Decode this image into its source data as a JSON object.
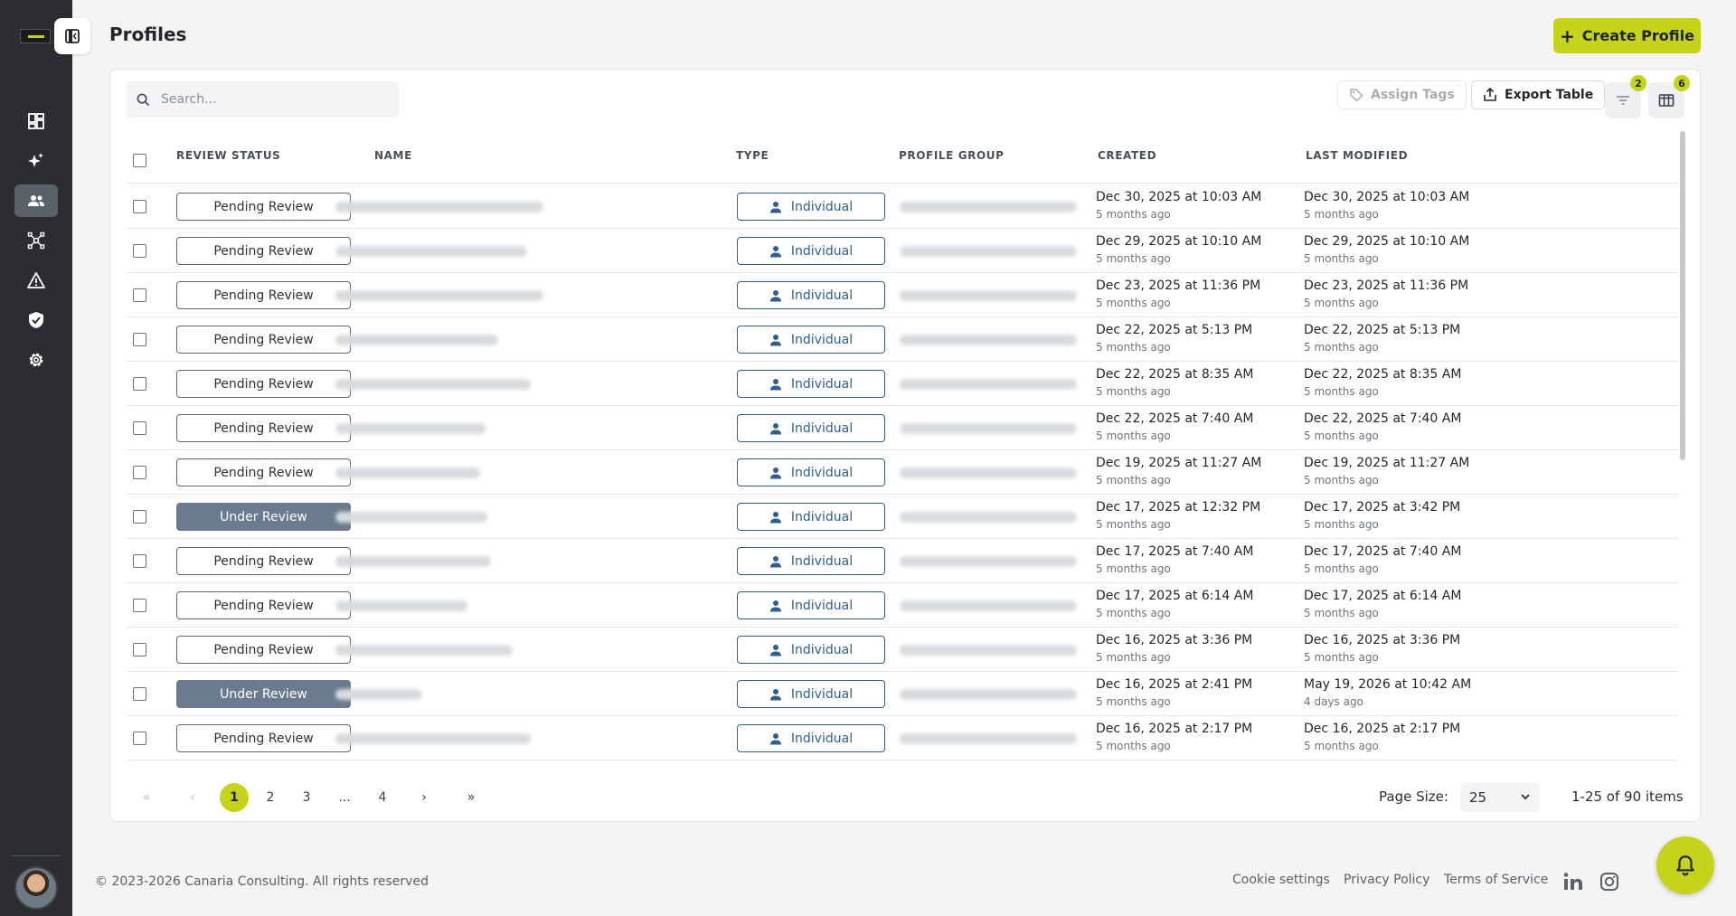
{
  "header": {
    "title": "Profiles",
    "create_label": "Create Profile"
  },
  "toolbar": {
    "search_placeholder": "Search...",
    "assign_tags_label": "Assign Tags",
    "export_label": "Export Table",
    "filter_count": "2",
    "columns_count": "6"
  },
  "table": {
    "columns": [
      "REVIEW STATUS",
      "NAME",
      "TYPE",
      "PROFILE GROUP",
      "CREATED",
      "LAST MODIFIED"
    ],
    "rows": [
      {
        "status": "Pending Review",
        "type": "Individual",
        "created": "Dec 30, 2025 at 10:03 AM",
        "created_ago": "5 months ago",
        "modified": "Dec 30, 2025 at 10:03 AM",
        "modified_ago": "5 months ago"
      },
      {
        "status": "Pending Review",
        "type": "Individual",
        "created": "Dec 29, 2025 at 10:10 AM",
        "created_ago": "5 months ago",
        "modified": "Dec 29, 2025 at 10:10 AM",
        "modified_ago": "5 months ago"
      },
      {
        "status": "Pending Review",
        "type": "Individual",
        "created": "Dec 23, 2025 at 11:36 PM",
        "created_ago": "5 months ago",
        "modified": "Dec 23, 2025 at 11:36 PM",
        "modified_ago": "5 months ago"
      },
      {
        "status": "Pending Review",
        "type": "Individual",
        "created": "Dec 22, 2025 at 5:13 PM",
        "created_ago": "5 months ago",
        "modified": "Dec 22, 2025 at 5:13 PM",
        "modified_ago": "5 months ago"
      },
      {
        "status": "Pending Review",
        "type": "Individual",
        "created": "Dec 22, 2025 at 8:35 AM",
        "created_ago": "5 months ago",
        "modified": "Dec 22, 2025 at 8:35 AM",
        "modified_ago": "5 months ago"
      },
      {
        "status": "Pending Review",
        "type": "Individual",
        "created": "Dec 22, 2025 at 7:40 AM",
        "created_ago": "5 months ago",
        "modified": "Dec 22, 2025 at 7:40 AM",
        "modified_ago": "5 months ago"
      },
      {
        "status": "Pending Review",
        "type": "Individual",
        "created": "Dec 19, 2025 at 11:27 AM",
        "created_ago": "5 months ago",
        "modified": "Dec 19, 2025 at 11:27 AM",
        "modified_ago": "5 months ago"
      },
      {
        "status": "Under Review",
        "type": "Individual",
        "created": "Dec 17, 2025 at 12:32 PM",
        "created_ago": "5 months ago",
        "modified": "Dec 17, 2025 at 3:42 PM",
        "modified_ago": "5 months ago"
      },
      {
        "status": "Pending Review",
        "type": "Individual",
        "created": "Dec 17, 2025 at 7:40 AM",
        "created_ago": "5 months ago",
        "modified": "Dec 17, 2025 at 7:40 AM",
        "modified_ago": "5 months ago"
      },
      {
        "status": "Pending Review",
        "type": "Individual",
        "created": "Dec 17, 2025 at 6:14 AM",
        "created_ago": "5 months ago",
        "modified": "Dec 17, 2025 at 6:14 AM",
        "modified_ago": "5 months ago"
      },
      {
        "status": "Pending Review",
        "type": "Individual",
        "created": "Dec 16, 2025 at 3:36 PM",
        "created_ago": "5 months ago",
        "modified": "Dec 16, 2025 at 3:36 PM",
        "modified_ago": "5 months ago"
      },
      {
        "status": "Under Review",
        "type": "Individual",
        "created": "Dec 16, 2025 at 2:41 PM",
        "created_ago": "5 months ago",
        "modified": "May 19, 2026 at 10:42 AM",
        "modified_ago": "4 days ago"
      },
      {
        "status": "Pending Review",
        "type": "Individual",
        "created": "Dec 16, 2025 at 2:17 PM",
        "created_ago": "5 months ago",
        "modified": "Dec 16, 2025 at 2:17 PM",
        "modified_ago": "5 months ago"
      }
    ]
  },
  "pagination": {
    "pages": [
      "1",
      "2",
      "3",
      "...",
      "4"
    ],
    "current": "1",
    "page_size_label": "Page Size:",
    "page_size": "25",
    "count_label": "1-25 of 90 items"
  },
  "footer": {
    "copyright": "© 2023-2026 Canaria Consulting. All rights reserved",
    "cookie": "Cookie settings",
    "privacy": "Privacy Policy",
    "terms": "Terms of Service"
  },
  "colors": {
    "accent": "#c6d419",
    "sidebar": "#2b2d30",
    "type_blue": "#2f5f8e",
    "under_review": "#6b7a8f"
  }
}
